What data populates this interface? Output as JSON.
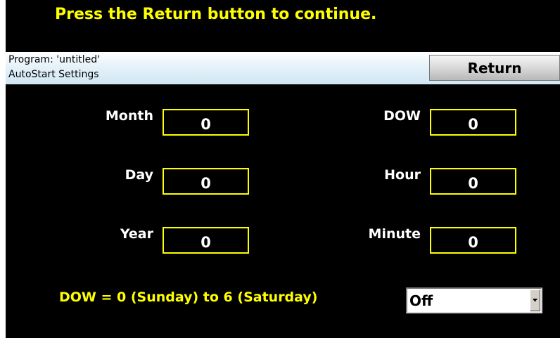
{
  "prompt": "Press the Return button to continue.",
  "header": {
    "program": "Program: 'untitled'",
    "subtitle": "AutoStart Settings",
    "return_label": "Return"
  },
  "fields": {
    "month": {
      "label": "Month",
      "value": "0"
    },
    "day": {
      "label": "Day",
      "value": "0"
    },
    "year": {
      "label": "Year",
      "value": "0"
    },
    "dow": {
      "label": "DOW",
      "value": "0"
    },
    "hour": {
      "label": "Hour",
      "value": "0"
    },
    "minute": {
      "label": "Minute",
      "value": "0"
    }
  },
  "note": "DOW = 0 (Sunday) to 6 (Saturday)",
  "autostart_select": {
    "value": "Off",
    "icon": "chevron-down-icon"
  },
  "colors": {
    "background": "#000000",
    "accent_yellow": "#ffff00",
    "label_white": "#ffffff",
    "header_gradient_end": "#cfe6f4"
  }
}
